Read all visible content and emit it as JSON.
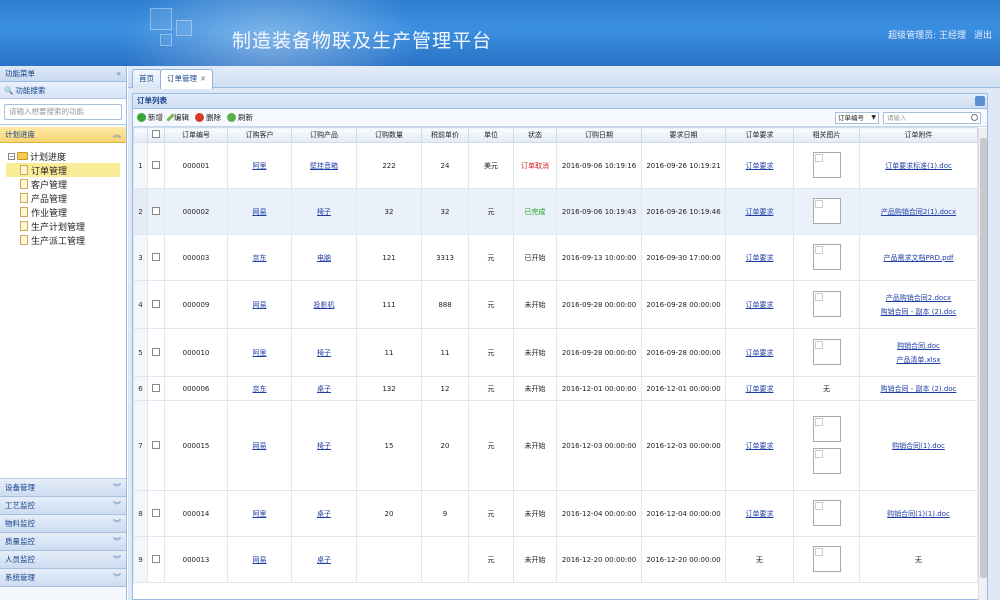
{
  "header": {
    "title": "制造装备物联及生产管理平台",
    "user": "超级管理员: 王经理",
    "logout": "退出"
  },
  "sidebar": {
    "menu_title": "功能菜单",
    "search_title": "功能搜索",
    "search_placeholder": "请输入想要搜索的功能",
    "active_section": "计划进度",
    "tree_root": "计划进度",
    "tree_items": [
      "订单管理",
      "客户管理",
      "产品管理",
      "作业管理",
      "生产计划管理",
      "生产派工管理"
    ],
    "sections": [
      "设备管理",
      "工艺监控",
      "物料监控",
      "质量监控",
      "人员监控",
      "系统管理"
    ]
  },
  "tabs": [
    {
      "label": "首页"
    },
    {
      "label": "订单管理"
    }
  ],
  "panel": {
    "title": "订单列表",
    "toolbar": {
      "add": "新增",
      "edit": "编辑",
      "delete": "删除",
      "refresh": "刷新"
    },
    "filter_select": "订单编号",
    "search_placeholder": "请输入"
  },
  "columns": [
    "订单编号",
    "订购客户",
    "订购产品",
    "订购数量",
    "税前单价",
    "单位",
    "状态",
    "订购日期",
    "要求日期",
    "订单要求",
    "相关图片",
    "订单附件"
  ],
  "rows": [
    {
      "n": "1",
      "id": "000001",
      "customer": "阿里",
      "product": "壁挂音箱",
      "qty": "222",
      "price": "24",
      "unit": "美元",
      "status": "订单取消",
      "status_color": "red",
      "order_date": "2016-09-06 10:19:16",
      "req_date": "2016-09-26 10:19:21",
      "req": "订单要求",
      "images": 1,
      "attachments": [
        "订单要求标准(1).doc"
      ]
    },
    {
      "n": "2",
      "id": "000002",
      "customer": "网易",
      "product": "椅子",
      "qty": "32",
      "price": "32",
      "unit": "元",
      "status": "已完成",
      "status_color": "green",
      "order_date": "2016-09-06 10:19:43",
      "req_date": "2016-09-26 10:19:46",
      "req": "订单要求",
      "images": 1,
      "attachments": [
        "产品购销合同2(1).docx"
      ]
    },
    {
      "n": "3",
      "id": "000003",
      "customer": "京东",
      "product": "电脑",
      "qty": "121",
      "price": "3313",
      "unit": "元",
      "status": "已开始",
      "status_color": "",
      "order_date": "2016-09-13 10:00:00",
      "req_date": "2016-09-30 17:00:00",
      "req": "订单要求",
      "images": 1,
      "attachments": [
        "产品需求文档PRD.pdf"
      ]
    },
    {
      "n": "4",
      "id": "000009",
      "customer": "网易",
      "product": "投影机",
      "qty": "111",
      "price": "888",
      "unit": "元",
      "status": "未开始",
      "status_color": "",
      "order_date": "2016-09-28 00:00:00",
      "req_date": "2016-09-28 00:00:00",
      "req": "订单要求",
      "images": 1,
      "attachments": [
        "产品购销合同2.docx",
        "购销合同 - 副本 (2).doc"
      ]
    },
    {
      "n": "5",
      "id": "000010",
      "customer": "阿里",
      "product": "椅子",
      "qty": "11",
      "price": "11",
      "unit": "元",
      "status": "未开始",
      "status_color": "",
      "order_date": "2016-09-28 00:00:00",
      "req_date": "2016-09-28 00:00:00",
      "req": "订单要求",
      "images": 1,
      "attachments": [
        "购销合同.doc",
        "产品清单.xlsx"
      ]
    },
    {
      "n": "6",
      "id": "000006",
      "customer": "京东",
      "product": "桌子",
      "qty": "132",
      "price": "12",
      "unit": "元",
      "status": "未开始",
      "status_color": "",
      "order_date": "2016-12-01 00:00:00",
      "req_date": "2016-12-01 00:00:00",
      "req": "订单要求",
      "images": 0,
      "images_text": "无",
      "attachments": [
        "购销合同 - 副本 (2).doc"
      ]
    },
    {
      "n": "7",
      "id": "000015",
      "customer": "网易",
      "product": "椅子",
      "qty": "15",
      "price": "20",
      "unit": "元",
      "status": "未开始",
      "status_color": "",
      "order_date": "2016-12-03 00:00:00",
      "req_date": "2016-12-03 00:00:00",
      "req": "订单要求",
      "images": 2,
      "attachments": [
        "购销合同(1).doc"
      ]
    },
    {
      "n": "8",
      "id": "000014",
      "customer": "阿里",
      "product": "桌子",
      "qty": "20",
      "price": "9",
      "unit": "元",
      "status": "未开始",
      "status_color": "",
      "order_date": "2016-12-04 00:00:00",
      "req_date": "2016-12-04 00:00:00",
      "req": "订单要求",
      "images": 1,
      "attachments": [
        "购销合同(1)(1).doc"
      ]
    },
    {
      "n": "9",
      "id": "000013",
      "customer": "网易",
      "product": "桌子",
      "qty": "",
      "price": "",
      "unit": "元",
      "status": "未开始",
      "status_color": "",
      "order_date": "2016-12-20 00:00:00",
      "req_date": "2016-12-20 00:00:00",
      "req": "无",
      "req_plain": true,
      "images": 1,
      "attachments": [],
      "attachments_text": "无"
    }
  ]
}
